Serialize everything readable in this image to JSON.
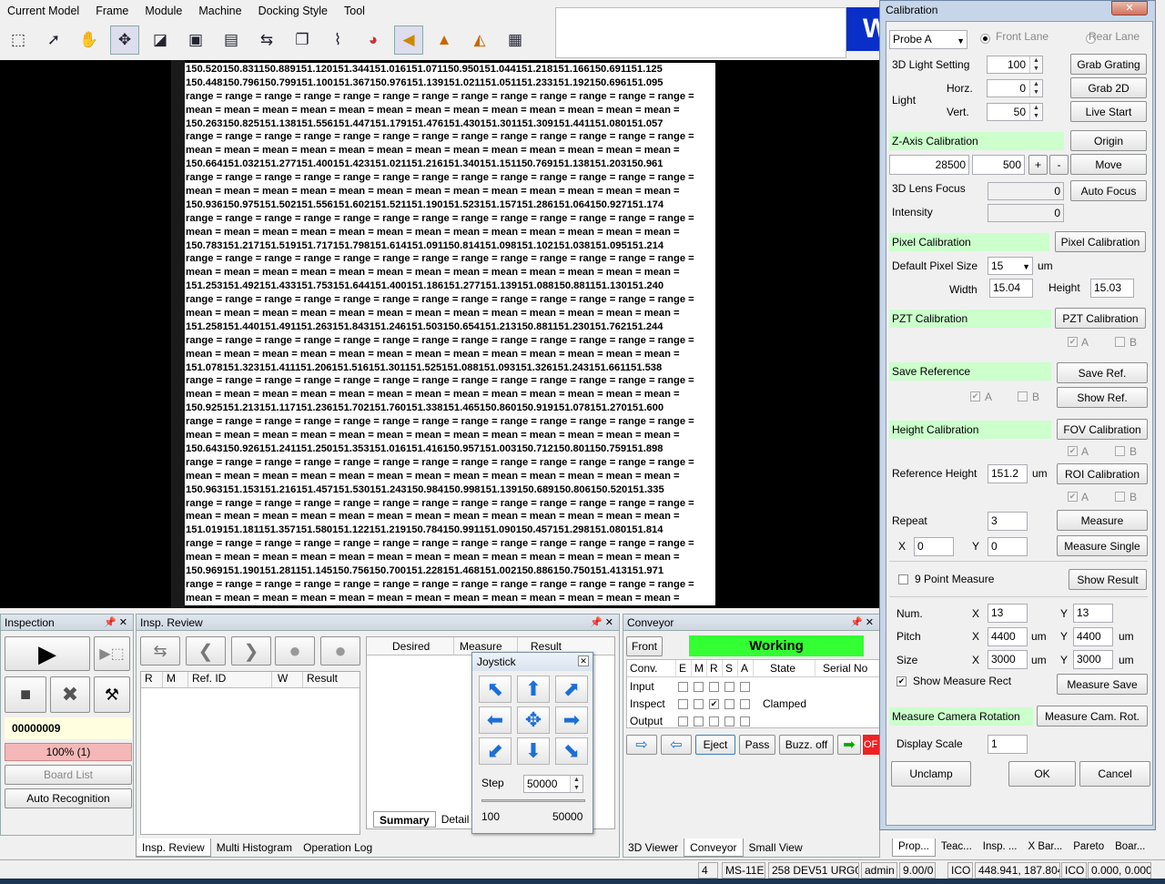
{
  "menu": [
    "Current Model",
    "Frame",
    "Module",
    "Machine",
    "Docking Style",
    "Tool"
  ],
  "logo_text": "W",
  "datagrid": {
    "rows": [
      "150.520150.831150.889151.120151.344151.016151.071150.950151.044151.218151.166150.691151.125",
      "150.448150.796150.799151.100151.367150.976151.139151.021151.051151.233151.192150.696151.095",
      "range = range = range = range = range = range = range = range = range = range = range = range = range =",
      "mean = mean = mean = mean = mean = mean = mean = mean = mean = mean = mean = mean = mean =",
      "150.263150.825151.138151.556151.447151.179151.476151.430151.301151.309151.441151.080151.057",
      "range = range = range = range = range = range = range = range = range = range = range = range = range =",
      "mean = mean = mean = mean = mean = mean = mean = mean = mean = mean = mean = mean = mean =",
      "150.664151.032151.277151.400151.423151.021151.216151.340151.151150.769151.138151.203150.961",
      "range = range = range = range = range = range = range = range = range = range = range = range = range =",
      "mean = mean = mean = mean = mean = mean = mean = mean = mean = mean = mean = mean = mean =",
      "150.936150.975151.502151.556151.602151.521151.190151.523151.157151.286151.064150.927151.174",
      "range = range = range = range = range = range = range = range = range = range = range = range = range =",
      "mean = mean = mean = mean = mean = mean = mean = mean = mean = mean = mean = mean = mean =",
      "150.783151.217151.519151.717151.798151.614151.091150.814151.098151.102151.038151.095151.214",
      "range = range = range = range = range = range = range = range = range = range = range = range = range =",
      "mean = mean = mean = mean = mean = mean = mean = mean = mean = mean = mean = mean = mean =",
      "151.253151.492151.433151.753151.644151.400151.186151.277151.139151.088150.881151.130151.240",
      "range = range = range = range = range = range = range = range = range = range = range = range = range =",
      "mean = mean = mean = mean = mean = mean = mean = mean = mean = mean = mean = mean = mean =",
      "151.258151.440151.491151.263151.843151.246151.503150.654151.213150.881151.230151.762151.244",
      "range = range = range = range = range = range = range = range = range = range = range = range = range =",
      "mean = mean = mean = mean = mean = mean = mean = mean = mean = mean = mean = mean = mean =",
      "151.078151.323151.411151.206151.516151.301151.525151.088151.093151.326151.243151.661151.538",
      "range = range = range = range = range = range = range = range = range = range = range = range = range =",
      "mean = mean = mean = mean = mean = mean = mean = mean = mean = mean = mean = mean = mean =",
      "150.925151.213151.117151.236151.702151.760151.338151.465150.860150.919151.078151.270151.600",
      "range = range = range = range = range = range = range = range = range = range = range = range = range =",
      "mean = mean = mean = mean = mean = mean = mean = mean = mean = mean = mean = mean = mean =",
      "150.643150.926151.241151.250151.353151.016151.416150.957151.003150.712150.801150.759151.898",
      "range = range = range = range = range = range = range = range = range = range = range = range = range =",
      "mean = mean = mean = mean = mean = mean = mean = mean = mean = mean = mean = mean = mean =",
      "150.963151.153151.216151.457151.530151.243150.984150.998151.139150.689150.806150.520151.335",
      "range = range = range = range = range = range = range = range = range = range = range = range = range =",
      "mean = mean = mean = mean = mean = mean = mean = mean = mean = mean = mean = mean = mean =",
      "151.019151.181151.357151.580151.122151.219150.784150.991151.090150.457151.298151.080151.814",
      "range = range = range = range = range = range = range = range = range = range = range = range = range =",
      "mean = mean = mean = mean = mean = mean = mean = mean = mean = mean = mean = mean = mean =",
      "150.969151.190151.281151.145150.756150.700151.228151.468151.002150.886150.750151.413151.971",
      "range = range = range = range = range = range = range = range = range = range = range = range = range =",
      "mean = mean = mean = mean = mean = mean = mean = mean = mean = mean = mean = mean = mean ="
    ]
  },
  "inspection": {
    "title": "Inspection",
    "serial": "00000009",
    "progress_text": "100% (1)",
    "board_list": "Board List",
    "auto_recognition": "Auto Recognition"
  },
  "insp_review": {
    "title": "Insp. Review",
    "columns": [
      "R",
      "M",
      "Ref. ID",
      "W",
      "Result"
    ],
    "right_columns": [
      "Desired",
      "Measure",
      "Result"
    ],
    "bottom_tabs": [
      "Summary",
      "Detail"
    ],
    "tabs": [
      "Insp. Review",
      "Multi Histogram",
      "Operation Log"
    ]
  },
  "joystick": {
    "title": "Joystick",
    "step_label": "Step",
    "step_value": "50000",
    "min": "100",
    "max": "50000"
  },
  "conveyor": {
    "title": "Conveyor",
    "front": "Front",
    "status": "Working",
    "columns": [
      "Conv.",
      "E",
      "M",
      "R",
      "S",
      "A",
      "State",
      "Serial No"
    ],
    "rows": [
      {
        "name": "Input",
        "state": ""
      },
      {
        "name": "Inspect",
        "state": "Clamped"
      },
      {
        "name": "Output",
        "state": ""
      }
    ],
    "buttons": [
      "Eject",
      "Pass",
      "Buzz. off"
    ],
    "red_label": "OF",
    "tabs": [
      "3D Viewer",
      "Conveyor",
      "Small View"
    ]
  },
  "calibration": {
    "title": "Calibration",
    "probe": "Probe A",
    "front_lane": "Front Lane",
    "rear_lane": "Rear Lane",
    "light_3d_label": "3D Light Setting",
    "light_3d_value": "100",
    "grab_grating": "Grab Grating",
    "light_label": "Light",
    "horz_label": "Horz.",
    "horz_value": "0",
    "grab_2d": "Grab 2D",
    "vert_label": "Vert.",
    "vert_value": "50",
    "live_start": "Live Start",
    "zaxis_label": "Z-Axis Calibration",
    "origin": "Origin",
    "zaxis_value": "28500",
    "zaxis_step": "500",
    "plus": "+",
    "minus": "-",
    "move": "Move",
    "lens_focus_label": "3D Lens Focus",
    "lens_focus_value": "0",
    "auto_focus": "Auto Focus",
    "intensity_label": "Intensity",
    "intensity_value": "0",
    "pixel_cal_label": "Pixel Calibration",
    "pixel_cal_button": "Pixel Calibration",
    "default_pixel_label": "Default Pixel Size",
    "default_pixel_value": "15",
    "um": "um",
    "width_label": "Width",
    "width_value": "15.04",
    "height_label": "Height",
    "height_value": "15.03",
    "pzt_label": "PZT Calibration",
    "pzt_button": "PZT Calibration",
    "a": "A",
    "b": "B",
    "save_ref_label": "Save Reference",
    "save_ref_button": "Save Ref.",
    "show_ref_button": "Show Ref.",
    "height_cal_label": "Height Calibration",
    "fov_button": "FOV Calibration",
    "ref_height_label": "Reference Height",
    "ref_height_value": "151.2",
    "roi_button": "ROI Calibration",
    "repeat_label": "Repeat",
    "repeat_value": "3",
    "measure_button": "Measure",
    "x_label": "X",
    "y_label": "Y",
    "x_value": "0",
    "y_value": "0",
    "measure_single": "Measure Single",
    "nine_point": "9 Point Measure",
    "show_result": "Show Result",
    "num_label": "Num.",
    "num_x": "13",
    "num_y": "13",
    "pitch_label": "Pitch",
    "pitch_x": "4400",
    "pitch_y": "4400",
    "size_label": "Size",
    "size_x": "3000",
    "size_y": "3000",
    "show_measure_rect": "Show Measure Rect",
    "measure_save": "Measure Save",
    "cam_rot_label": "Measure Camera Rotation",
    "cam_rot_button": "Measure Cam. Rot.",
    "display_scale_label": "Display Scale",
    "display_scale_value": "1",
    "unclamp": "Unclamp",
    "ok": "OK",
    "cancel": "Cancel",
    "tabs": [
      "Prop...",
      "Teac...",
      "Insp. ...",
      "X Bar...",
      "Pareto",
      "Boar..."
    ]
  },
  "status": {
    "num": "4",
    "model": "MS-11E",
    "dev": "258 DEV51 URG02",
    "user": "admin",
    "version": "9.00/0",
    "ico1": "ICO",
    "coord1": "448.941, 187.804",
    "ico2": "ICO",
    "coord2": "0.000, 0.000"
  },
  "colors": {
    "green_status": "#33ff33",
    "section_green": "#ccffcc",
    "logo_blue": "#0a2fc8",
    "accent_blue": "#1c6fd8"
  }
}
